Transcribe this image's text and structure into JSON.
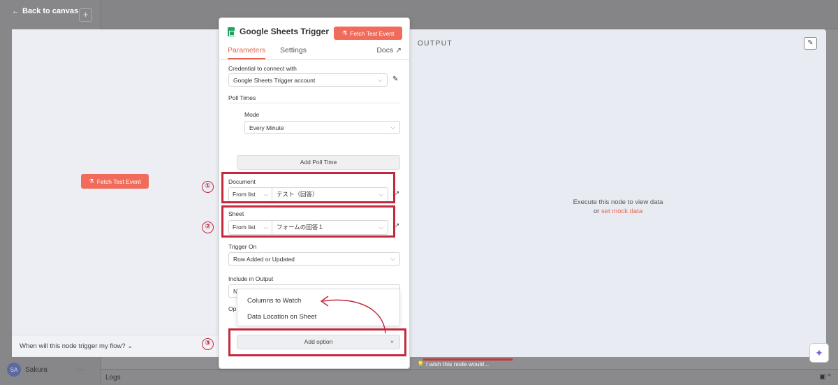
{
  "background": {
    "user_initials": "SA",
    "user_name": "Sakura",
    "user_menu": "···",
    "logs_label": "Logs",
    "logs_icons": "▣ ^"
  },
  "modal": {
    "back_label": "Back to canvas",
    "fetch_test_left": "Fetch Test Event",
    "trigger_help": "When will this node trigger my flow?",
    "output_title": "OUTPUT",
    "exec_msg_line1": "Execute this node to view data",
    "exec_msg_or": "or",
    "exec_msg_mock": "set mock data",
    "wish_text": "I wish this node would..."
  },
  "panel": {
    "title": "Google Sheets Trigger",
    "fetch_test": "Fetch Test Event",
    "tabs": {
      "parameters": "Parameters",
      "settings": "Settings",
      "docs": "Docs"
    },
    "credential_label": "Credential to connect with",
    "credential_value": "Google Sheets Trigger account",
    "poll_times_label": "Poll Times",
    "mode_label": "Mode",
    "mode_value": "Every Minute",
    "add_poll_time": "Add Poll Time",
    "document_label": "Document",
    "document_mode": "From list",
    "document_value": "テスト（回答）",
    "sheet_label": "Sheet",
    "sheet_mode": "From list",
    "sheet_value": "フォームの回答１",
    "trigger_on_label": "Trigger On",
    "trigger_on_value": "Row Added or Updated",
    "include_output_label": "Include in Output",
    "include_output_value": "N",
    "options_label": "Op",
    "add_option": "Add option"
  },
  "dropdown": {
    "items": [
      "Columns to Watch",
      "Data Location on Sheet"
    ]
  },
  "annotations": [
    "①",
    "②",
    "③"
  ],
  "colors": {
    "accent": "#e8624f",
    "annotation": "#c5283d",
    "sheets_green": "#1fa463"
  }
}
